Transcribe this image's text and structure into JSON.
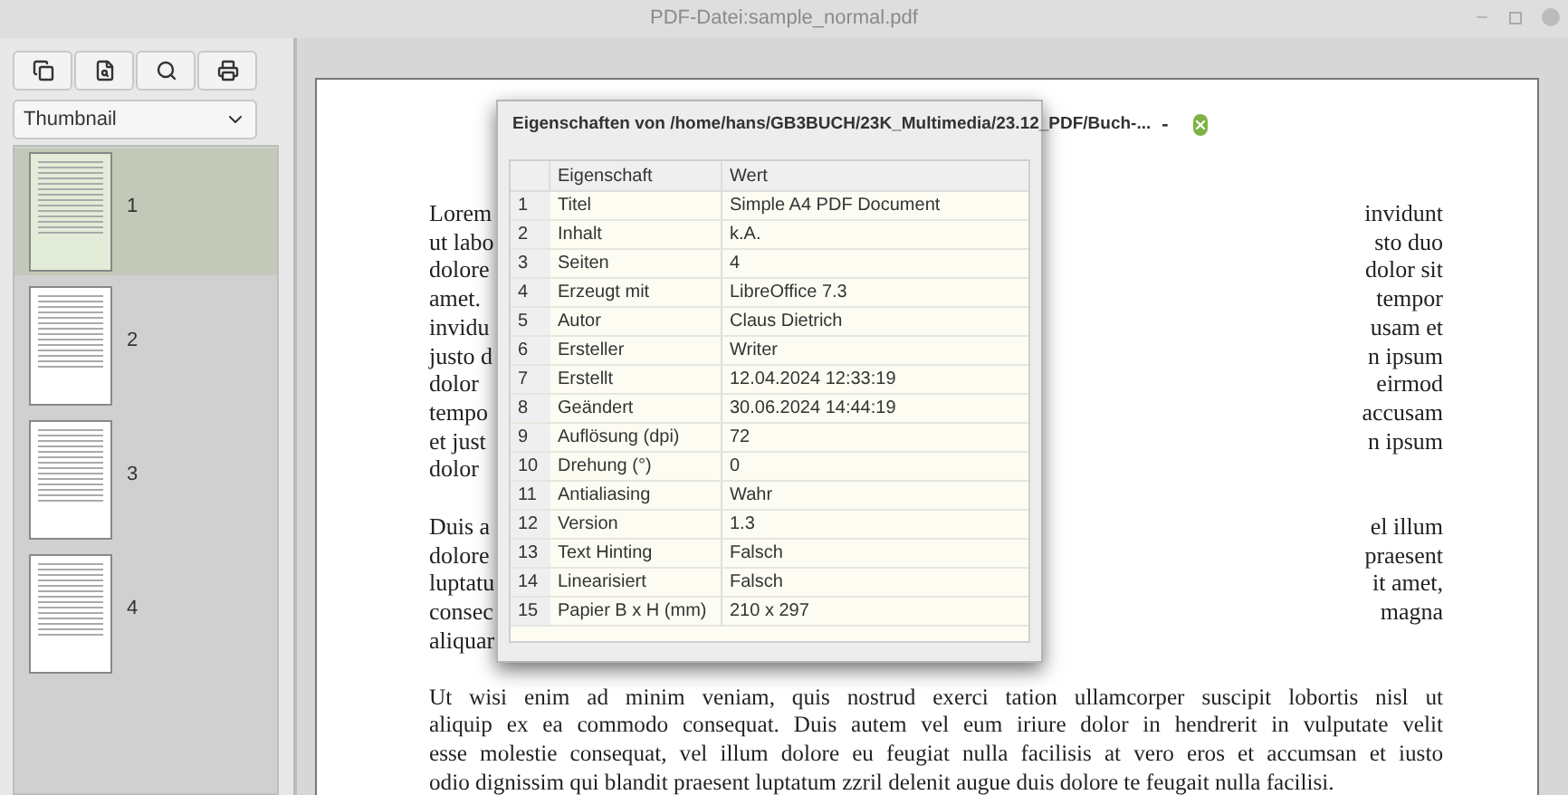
{
  "window": {
    "title": "PDF-Datei:sample_normal.pdf"
  },
  "toolbar": {
    "view_select": "Thumbnail"
  },
  "thumbnails": [
    {
      "label": "1",
      "selected": true
    },
    {
      "label": "2",
      "selected": false
    },
    {
      "label": "3",
      "selected": false
    },
    {
      "label": "4",
      "selected": false
    }
  ],
  "document": {
    "paragraphs": [
      {
        "lines": [
          {
            "left": "Lorem",
            "right": "invidunt"
          },
          {
            "left": "ut labo",
            "right": "sto duo"
          },
          {
            "left": "dolore",
            "right": "dolor sit"
          },
          {
            "left": "amet.",
            "right": "tempor"
          },
          {
            "left": "invidu",
            "right": "usam et"
          },
          {
            "left": "justo d",
            "right": "n ipsum"
          },
          {
            "left": "dolor",
            "right": "eirmod"
          },
          {
            "left": "tempo",
            "right": "accusam"
          },
          {
            "left": "et just",
            "right": "n ipsum"
          },
          {
            "left": "dolor"
          }
        ]
      },
      {
        "lines": [
          {
            "left": "Duis a",
            "right": "el illum"
          },
          {
            "left": "dolore",
            "right": "praesent"
          },
          {
            "left": "luptatu",
            "right": "it amet,"
          },
          {
            "left": "consec",
            "right": "magna"
          },
          {
            "left": "aliquar"
          }
        ]
      },
      {
        "text_lines": [
          "Ut wisi enim ad minim veniam, quis nostrud exerci tation ullamcorper suscipit lobortis nisl ut",
          "aliquip ex ea commodo consequat. Duis autem vel eum iriure dolor in hendrerit in vulputate velit",
          "esse molestie consequat, vel illum dolore eu feugiat nulla facilisis at vero eros et accumsan et iusto",
          "odio dignissim qui blandit praesent luptatum zzril delenit augue duis dolore te feugait nulla facilisi."
        ]
      }
    ]
  },
  "dialog": {
    "title": "Eigenschaften von /home/hans/GB3BUCH/23K_Multimedia/23.12_PDF/Buch-...",
    "minimize": "-",
    "columns": [
      "Eigenschaft",
      "Wert"
    ],
    "rows": [
      {
        "index": "1",
        "property": "Titel",
        "value": "Simple A4 PDF Document"
      },
      {
        "index": "2",
        "property": "Inhalt",
        "value": "k.A."
      },
      {
        "index": "3",
        "property": "Seiten",
        "value": "4"
      },
      {
        "index": "4",
        "property": "Erzeugt mit",
        "value": "LibreOffice 7.3"
      },
      {
        "index": "5",
        "property": "Autor",
        "value": "Claus Dietrich"
      },
      {
        "index": "6",
        "property": "Ersteller",
        "value": "Writer"
      },
      {
        "index": "7",
        "property": "Erstellt",
        "value": "12.04.2024 12:33:19"
      },
      {
        "index": "8",
        "property": "Geändert",
        "value": "30.06.2024 14:44:19"
      },
      {
        "index": "9",
        "property": "Auflösung (dpi)",
        "value": "72"
      },
      {
        "index": "10",
        "property": "Drehung (°)",
        "value": "0"
      },
      {
        "index": "11",
        "property": "Antialiasing",
        "value": "Wahr"
      },
      {
        "index": "12",
        "property": "Version",
        "value": "1.3"
      },
      {
        "index": "13",
        "property": "Text Hinting",
        "value": "Falsch"
      },
      {
        "index": "14",
        "property": "Linearisiert",
        "value": "Falsch"
      },
      {
        "index": "15",
        "property": "Papier B x H (mm)",
        "value": "210 x 297"
      }
    ]
  }
}
